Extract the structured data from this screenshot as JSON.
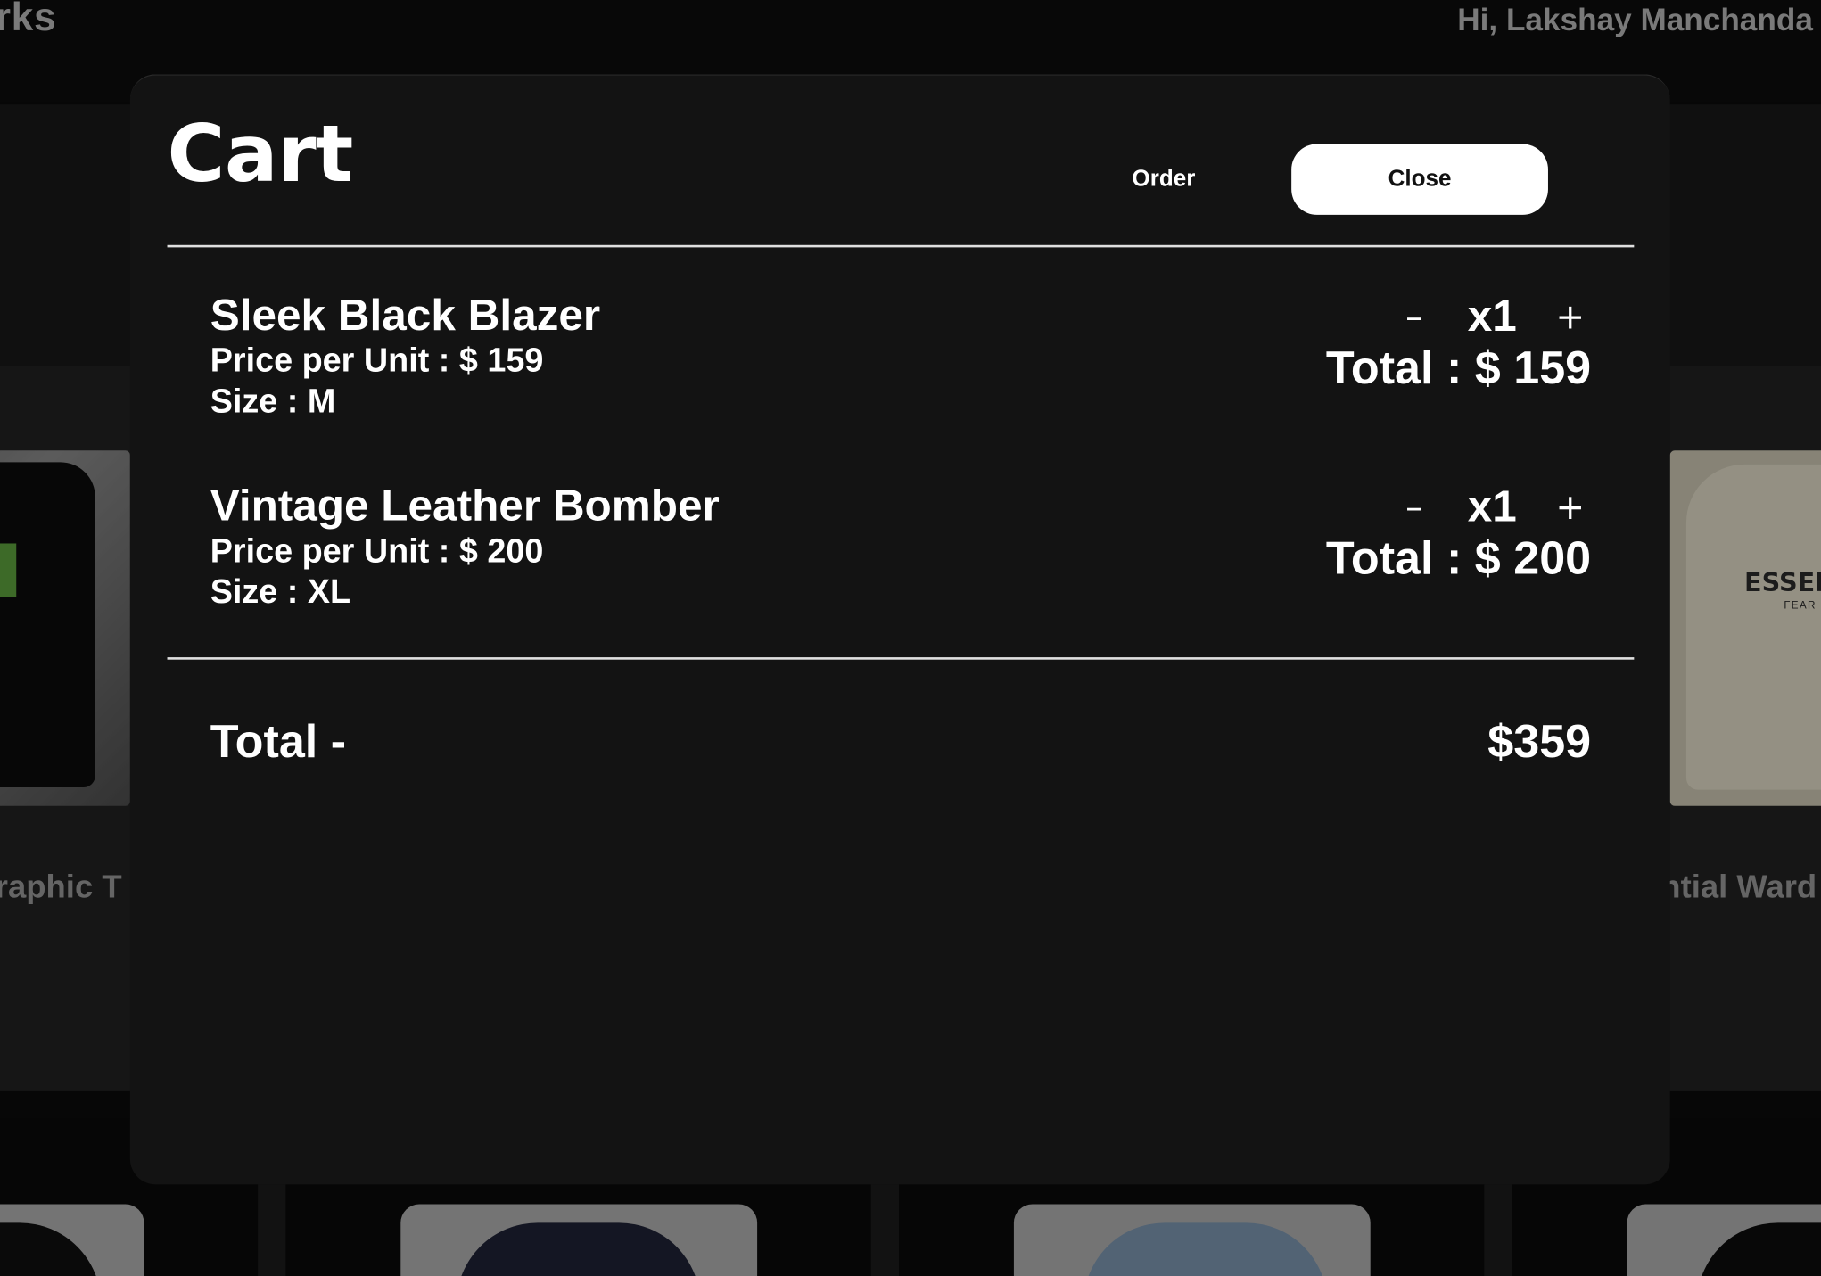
{
  "header": {
    "brand_partial": "rks",
    "greeting": "Hi, Lakshay Manchanda"
  },
  "background": {
    "card_left_label": "raphic T",
    "card_right_label": "ntial Ward",
    "card_right_print": "ESSENT",
    "card_right_print_sub": "FEAR OF G"
  },
  "cart": {
    "title": "Cart",
    "order_label": "Order",
    "close_label": "Close",
    "items": [
      {
        "name": "Sleek Black Blazer",
        "price_line": "Price per Unit : $ 159",
        "size_line": "Size : M",
        "minus": "–",
        "quantity": "x1",
        "plus": "+",
        "total_line": "Total : $ 159"
      },
      {
        "name": "Vintage Leather Bomber",
        "price_line": "Price per Unit : $ 200",
        "size_line": "Size : XL",
        "minus": "–",
        "quantity": "x1",
        "plus": "+",
        "total_line": "Total : $ 200"
      }
    ],
    "grand_total_label": "Total -",
    "grand_total_value": "$359"
  },
  "colors": {
    "modal_bg": "#131313",
    "page_bg": "#0b0b0b",
    "button_bg": "#ffffff",
    "text": "#ffffff"
  }
}
